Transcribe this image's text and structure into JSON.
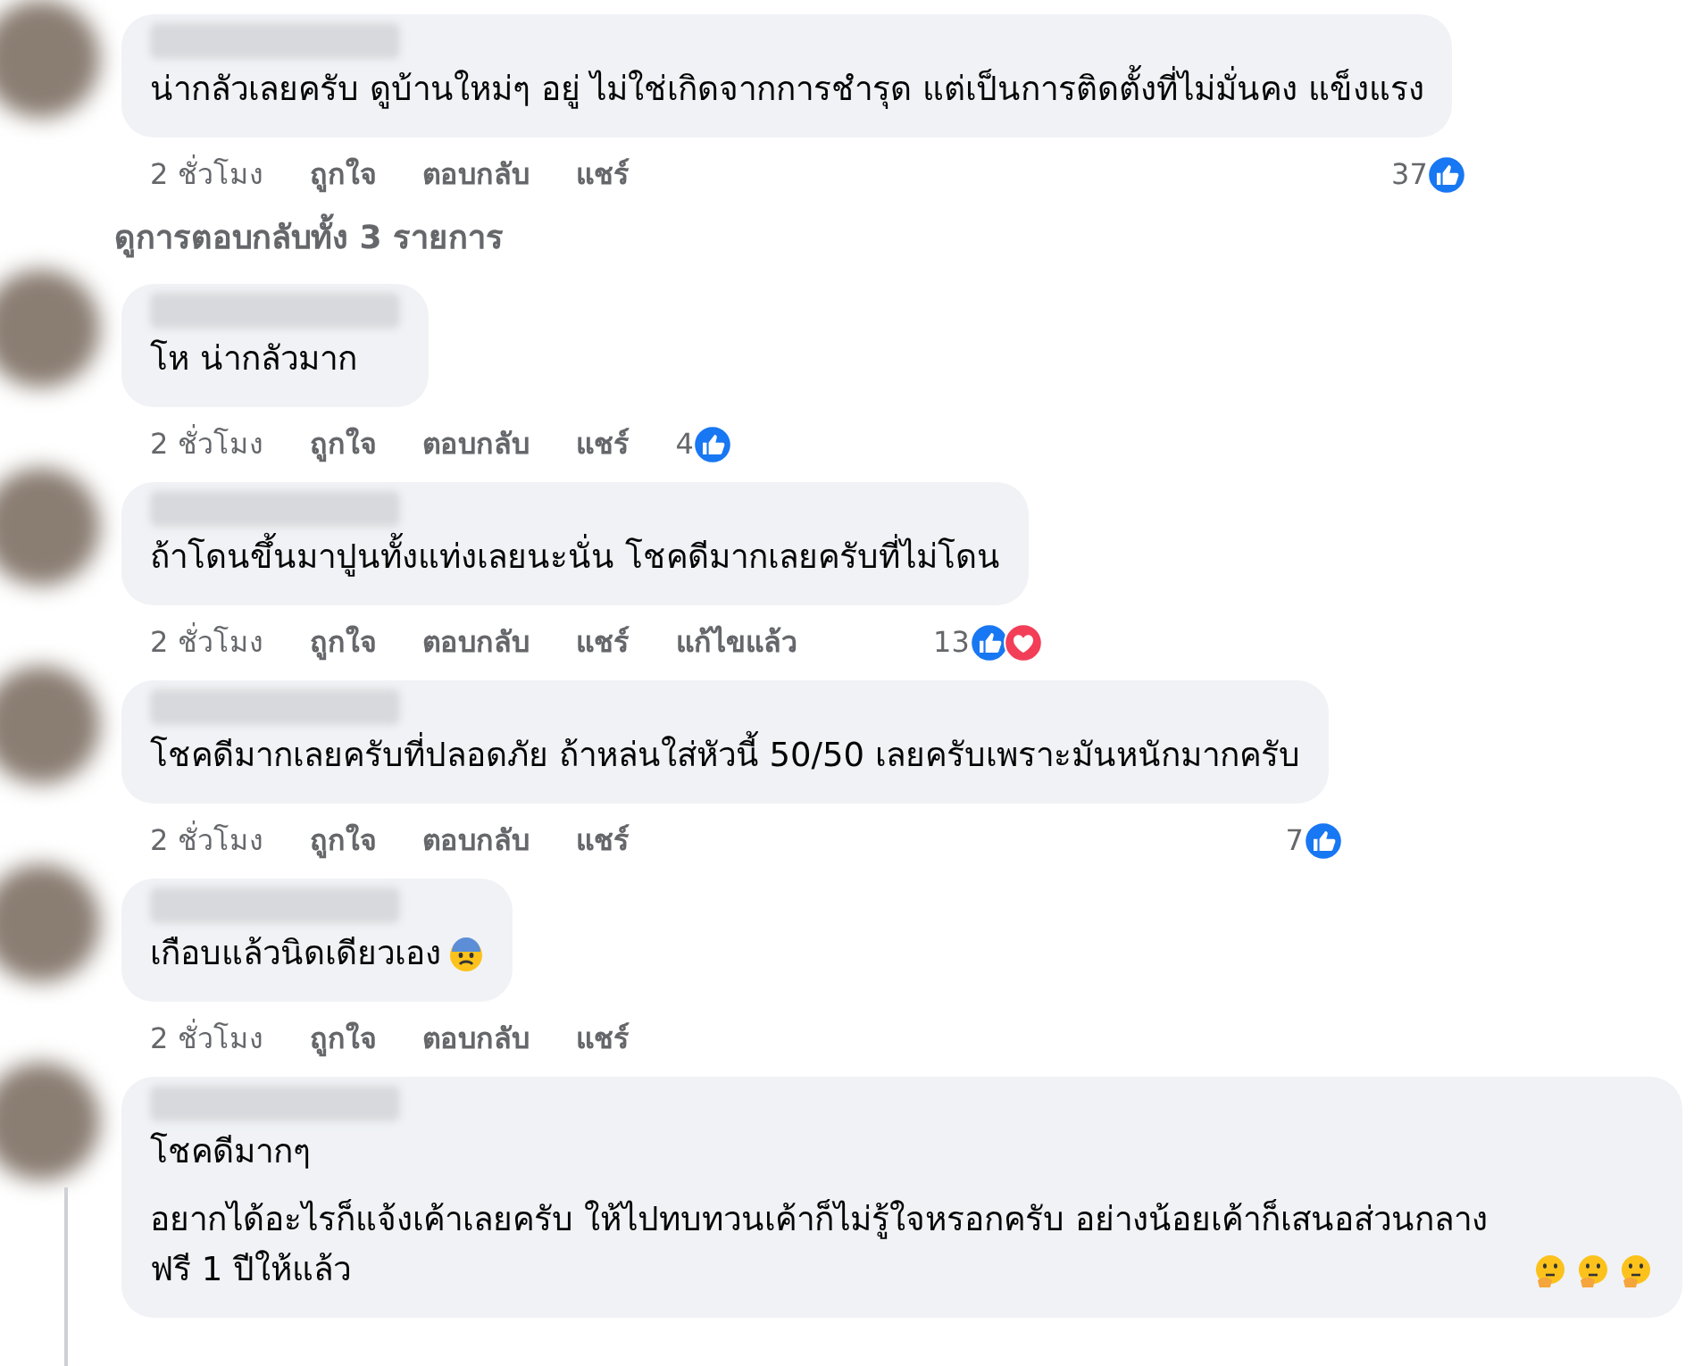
{
  "comments": [
    {
      "paragraphs": [
        "น่ากลัวเลยครับ ดูบ้านใหม่ๆ อยู่ ไม่ใช่เกิดจากการชำรุด แต่เป็นการติดตั้งที่ไม่มั่นคง แข็งแรง"
      ],
      "actions": [
        "2 ชั่วโมง",
        "ถูกใจ",
        "ตอบกลับ",
        "แชร์"
      ],
      "reaction_count": "37",
      "reactions": [
        {
          "kind": "like"
        }
      ],
      "view_replies": "ดูการตอบกลับทั้ง 3 รายการ"
    },
    {
      "paragraphs": [
        "โห น่ากลัวมาก"
      ],
      "actions": [
        "2 ชั่วโมง",
        "ถูกใจ",
        "ตอบกลับ",
        "แชร์"
      ],
      "reaction_count": "4",
      "reactions": [
        {
          "kind": "like"
        }
      ]
    },
    {
      "paragraphs": [
        "ถ้าโดนขึ้นมาปูนทั้งแท่งเลยนะนั่น โชคดีมากเลยครับที่ไม่โดน"
      ],
      "actions": [
        "2 ชั่วโมง",
        "ถูกใจ",
        "ตอบกลับ",
        "แชร์",
        "แก้ไขแล้ว"
      ],
      "reaction_count": "13",
      "reactions": [
        {
          "kind": "like"
        },
        {
          "kind": "love"
        }
      ]
    },
    {
      "paragraphs": [
        "โชคดีมากเลยครับที่ปลอดภัย ถ้าหล่นใส่หัวนี้ 50/50 เลยครับเพราะมันหนักมากครับ"
      ],
      "actions": [
        "2 ชั่วโมง",
        "ถูกใจ",
        "ตอบกลับ",
        "แชร์"
      ],
      "reaction_count": "7",
      "reactions": [
        {
          "kind": "like"
        }
      ]
    },
    {
      "paragraphs": [
        "เกือบแล้วนิดเดียวเอง"
      ],
      "emojis": [
        {
          "kind": "anxious"
        }
      ],
      "actions": [
        "2 ชั่วโมง",
        "ถูกใจ",
        "ตอบกลับ",
        "แชร์"
      ]
    },
    {
      "paragraphs": [
        "โชคดีมากๆ",
        "อยากได้อะไรก็แจ้งเค้าเลยครับ ให้ไปทบทวนเค้าก็ไม่รู้ใจหรอกครับ อย่างน้อยเค้าก็เสนอส่วนกลาง ฟรี 1 ปีให้แล้ว"
      ],
      "emojis": [
        {
          "kind": "thinking"
        },
        {
          "kind": "thinking"
        },
        {
          "kind": "thinking"
        }
      ],
      "thread_line": true
    }
  ]
}
